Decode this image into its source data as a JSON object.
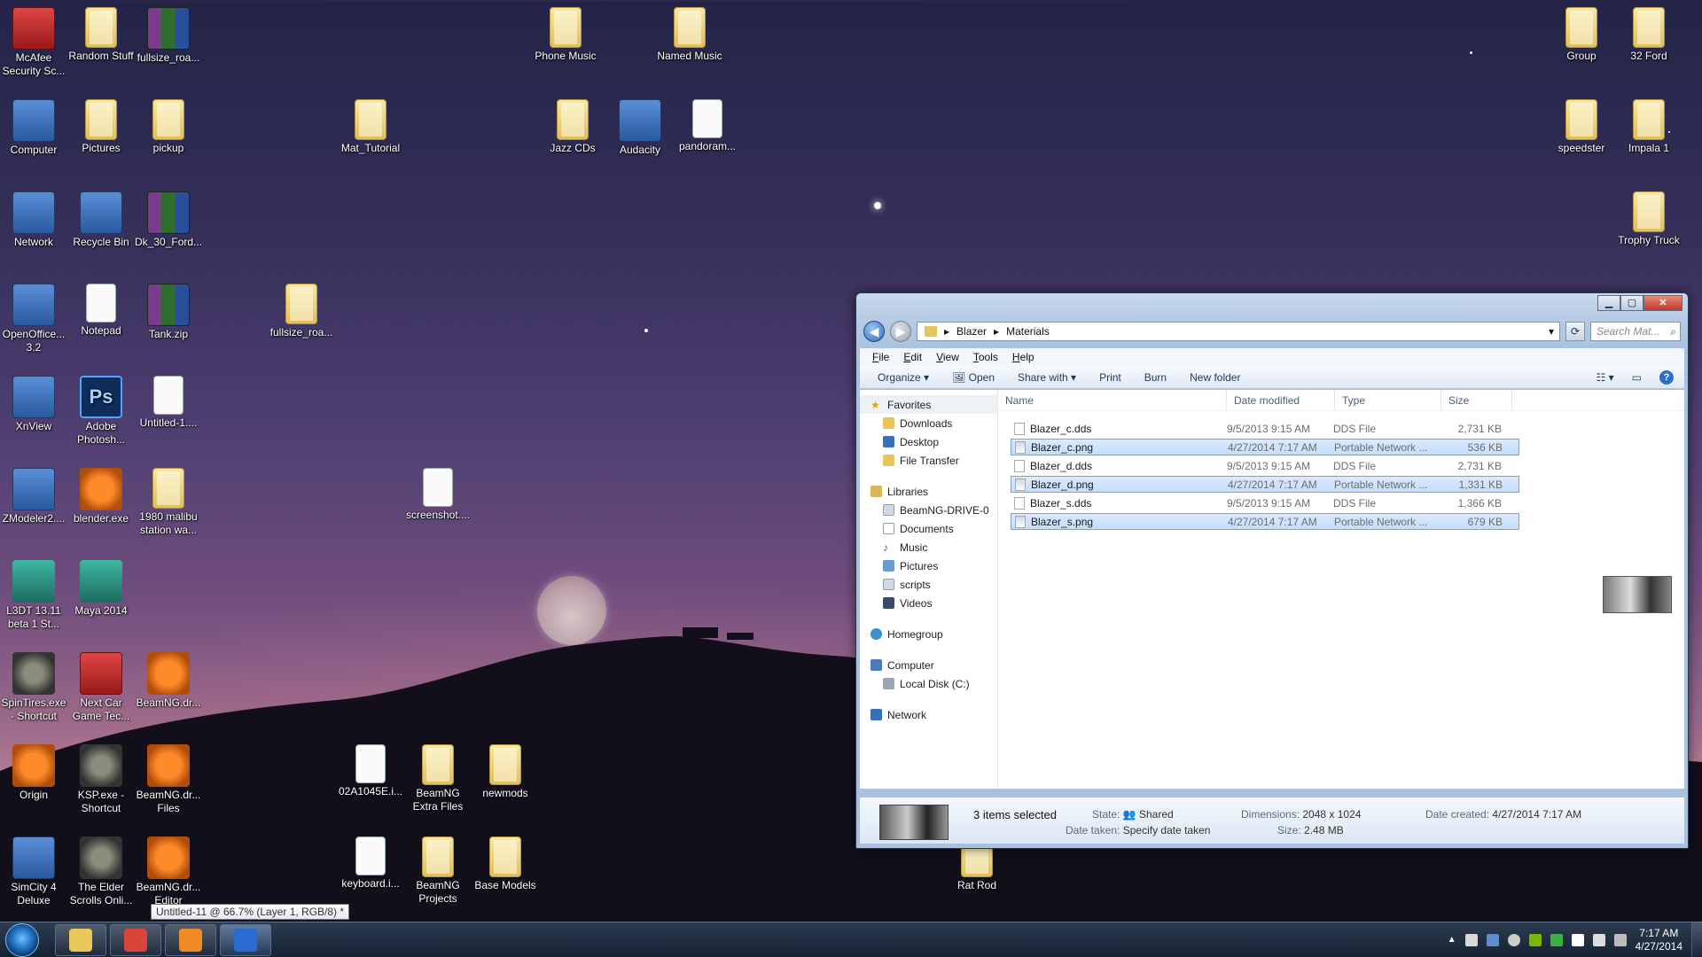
{
  "desktop": {
    "icons": [
      {
        "label": "McAfee Security Sc...",
        "icon": "mcafee-icon"
      },
      {
        "label": "Random Stuff",
        "icon": "folder-icon"
      },
      {
        "label": "fullsize_roa...",
        "icon": "winrar-archive-icon"
      },
      {
        "label": "Phone Music",
        "icon": "folder-icon"
      },
      {
        "label": "Named Music",
        "icon": "folder-icon"
      },
      {
        "label": "Group",
        "icon": "folder-icon"
      },
      {
        "label": "32 Ford",
        "icon": "folder-icon"
      },
      {
        "label": "Computer",
        "icon": "computer-icon"
      },
      {
        "label": "Pictures",
        "icon": "folder-icon"
      },
      {
        "label": "pickup",
        "icon": "folder-icon"
      },
      {
        "label": "Mat_Tutorial",
        "icon": "folder-icon"
      },
      {
        "label": "Jazz CDs",
        "icon": "folder-icon"
      },
      {
        "label": "Audacity",
        "icon": "audacity-icon"
      },
      {
        "label": "pandoram...",
        "icon": "document-icon"
      },
      {
        "label": "speedster",
        "icon": "folder-icon"
      },
      {
        "label": "Impala 1",
        "icon": "folder-icon"
      },
      {
        "label": "Network",
        "icon": "network-globe-icon"
      },
      {
        "label": "Recycle Bin",
        "icon": "recycle-bin-icon"
      },
      {
        "label": "Dk_30_Ford...",
        "icon": "winrar-archive-icon"
      },
      {
        "label": "Trophy Truck",
        "icon": "folder-icon"
      },
      {
        "label": "OpenOffice... 3.2",
        "icon": "openoffice-icon"
      },
      {
        "label": "Notepad",
        "icon": "notepad-icon"
      },
      {
        "label": "Tank.zip",
        "icon": "winrar-archive-icon"
      },
      {
        "label": "fullsize_roa...",
        "icon": "folder-icon"
      },
      {
        "label": "XnView",
        "icon": "xnview-icon"
      },
      {
        "label": "Adobe Photosh...",
        "icon": "photoshop-icon"
      },
      {
        "label": "Untitled-1....",
        "icon": "image-file-icon"
      },
      {
        "label": "ZModeler2....",
        "icon": "zmodeler-icon"
      },
      {
        "label": "blender.exe",
        "icon": "blender-icon"
      },
      {
        "label": "1980 malibu station wa...",
        "icon": "folder-icon"
      },
      {
        "label": "screenshot....",
        "icon": "image-file-icon"
      },
      {
        "label": "L3DT 13.11 beta 1 St...",
        "icon": "l3dt-icon"
      },
      {
        "label": "Maya 2014",
        "icon": "maya-icon"
      },
      {
        "label": "SpinTires.exe - Shortcut",
        "icon": "spintires-icon"
      },
      {
        "label": "Next Car Game Tec...",
        "icon": "ncg-icon"
      },
      {
        "label": "BeamNG.dr...",
        "icon": "beamng-icon"
      },
      {
        "label": "Origin",
        "icon": "origin-icon"
      },
      {
        "label": "KSP.exe - Shortcut",
        "icon": "ksp-icon"
      },
      {
        "label": "BeamNG.dr... Files",
        "icon": "beamng-icon"
      },
      {
        "label": "02A1045E.i...",
        "icon": "document-icon"
      },
      {
        "label": "BeamNG Extra Files",
        "icon": "folder-icon"
      },
      {
        "label": "newmods",
        "icon": "folder-icon"
      },
      {
        "label": "SimCity 4 Deluxe",
        "icon": "simcity-icon"
      },
      {
        "label": "The Elder Scrolls Onli...",
        "icon": "eso-icon"
      },
      {
        "label": "BeamNG.dr... Editor",
        "icon": "beamng-editor-icon"
      },
      {
        "label": "keyboard.i...",
        "icon": "document-icon"
      },
      {
        "label": "BeamNG Projects",
        "icon": "folder-icon"
      },
      {
        "label": "Base Models",
        "icon": "folder-icon"
      },
      {
        "label": "Rat Rod",
        "icon": "folder-icon"
      }
    ]
  },
  "explorer": {
    "breadcrumb": [
      "Blazer",
      "Materials"
    ],
    "search_placeholder": "Search Mat...",
    "menus": [
      "File",
      "Edit",
      "View",
      "Tools",
      "Help"
    ],
    "commands": {
      "organize": "Organize ▾",
      "open": "Open",
      "share": "Share with ▾",
      "print": "Print",
      "burn": "Burn",
      "new_folder": "New folder"
    },
    "nav": {
      "favorites": "Favorites",
      "downloads": "Downloads",
      "desktop": "Desktop",
      "file_transfer": "File Transfer",
      "libraries": "Libraries",
      "beamng_drive": "BeamNG-DRIVE-0",
      "documents": "Documents",
      "music": "Music",
      "pictures": "Pictures",
      "scripts": "scripts",
      "videos": "Videos",
      "homegroup": "Homegroup",
      "computer": "Computer",
      "local_disk": "Local Disk (C:)",
      "network": "Network"
    },
    "columns": {
      "name": "Name",
      "date": "Date modified",
      "type": "Type",
      "size": "Size"
    },
    "files": [
      {
        "name": "Blazer_c.dds",
        "date": "9/5/2013 9:15 AM",
        "type": "DDS File",
        "size": "2,731 KB",
        "selected": false
      },
      {
        "name": "Blazer_c.png",
        "date": "4/27/2014 7:17 AM",
        "type": "Portable Network ...",
        "size": "536 KB",
        "selected": true
      },
      {
        "name": "Blazer_d.dds",
        "date": "9/5/2013 9:15 AM",
        "type": "DDS File",
        "size": "2,731 KB",
        "selected": false
      },
      {
        "name": "Blazer_d.png",
        "date": "4/27/2014 7:17 AM",
        "type": "Portable Network ...",
        "size": "1,331 KB",
        "selected": true
      },
      {
        "name": "Blazer_s.dds",
        "date": "9/5/2013 9:15 AM",
        "type": "DDS File",
        "size": "1,366 KB",
        "selected": false
      },
      {
        "name": "Blazer_s.png",
        "date": "4/27/2014 7:17 AM",
        "type": "Portable Network ...",
        "size": "679 KB",
        "selected": true
      }
    ],
    "details": {
      "selected": "3 items selected",
      "state_label": "State:",
      "state": "Shared",
      "taken_label": "Date taken:",
      "taken": "Specify date taken",
      "dim_label": "Dimensions:",
      "dimensions": "2048 x 1024",
      "size_label": "Size:",
      "size": "2.48 MB",
      "created_label": "Date created:",
      "created": "4/27/2014 7:17 AM"
    }
  },
  "tooltip": "Untitled-11 @ 66.7% (Layer 1, RGB/8) *",
  "taskbar": {
    "apps": [
      {
        "name": "explorer-icon",
        "color": "#e9c75a"
      },
      {
        "name": "chrome-icon",
        "color": "#d9453b"
      },
      {
        "name": "blender-icon",
        "color": "#f08a24"
      },
      {
        "name": "photoshop-icon",
        "color": "#2a6ad1"
      }
    ],
    "time": "7:17 AM",
    "date": "4/27/2014"
  }
}
